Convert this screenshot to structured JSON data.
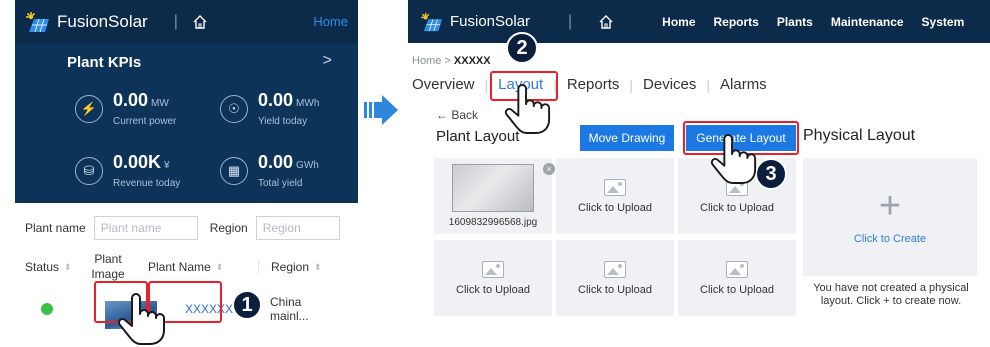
{
  "left": {
    "brand": "FusionSolar",
    "home_link": "Home",
    "kpi_title": "Plant KPIs",
    "kpis": [
      {
        "value": "0.00",
        "unit": "MW",
        "label": "Current power"
      },
      {
        "value": "0.00",
        "unit": "MWh",
        "label": "Yield today"
      },
      {
        "value": "0.00K",
        "unit": "¥",
        "label": "Revenue today"
      },
      {
        "value": "0.00",
        "unit": "GWh",
        "label": "Total yield"
      }
    ],
    "filter_plant_label": "Plant name",
    "filter_plant_placeholder": "Plant name",
    "filter_region_label": "Region",
    "filter_region_placeholder": "Region",
    "columns": [
      "Status",
      "Plant Image",
      "Plant Name",
      "Region"
    ],
    "row": {
      "plant_name": "XXXXXX",
      "region": "China mainl..."
    }
  },
  "right": {
    "brand": "FusionSolar",
    "nav": [
      "Home",
      "Reports",
      "Plants",
      "Maintenance",
      "System"
    ],
    "breadcrumb_home": "Home",
    "breadcrumb_sep": ">",
    "breadcrumb_current": "XXXXX",
    "tabs": [
      "Overview",
      "Layout",
      "Reports",
      "Devices",
      "Alarms"
    ],
    "back": "Back",
    "title": "Plant Layout",
    "move_drawing": "Move Drawing",
    "generate_layout": "Generate Layout",
    "physical_layout": "Physical Layout",
    "file_name": "1609832996568.jpg",
    "upload_label": "Click to Upload",
    "create_label": "Click to Create",
    "create_hint": "You have not created a physical layout. Click + to create now."
  },
  "steps": [
    "1",
    "2",
    "3"
  ],
  "colors": {
    "navbar": "#0c2a4a",
    "kpi_bg": "#0d3358",
    "accent": "#1c78e3",
    "highlight": "#e8212a",
    "status_ok": "#3cc14a"
  }
}
